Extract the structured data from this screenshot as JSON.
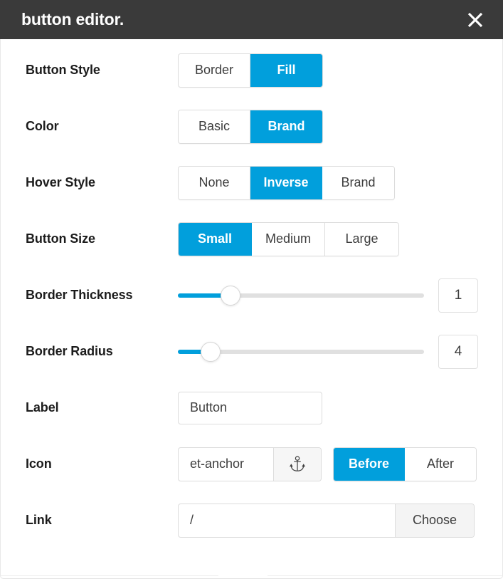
{
  "header": {
    "title": "button editor.",
    "close_label": "×"
  },
  "rows": {
    "button_style": {
      "label": "Button Style",
      "options": [
        "Border",
        "Fill"
      ],
      "selected": "Fill"
    },
    "color": {
      "label": "Color",
      "options": [
        "Basic",
        "Brand"
      ],
      "selected": "Brand"
    },
    "hover_style": {
      "label": "Hover Style",
      "options": [
        "None",
        "Inverse",
        "Brand"
      ],
      "selected": "Inverse"
    },
    "button_size": {
      "label": "Button Size",
      "options": [
        "Small",
        "Medium",
        "Large"
      ],
      "selected": "Small"
    },
    "border_thickness": {
      "label": "Border Thickness",
      "value": "1",
      "percent": 21
    },
    "border_radius": {
      "label": "Border Radius",
      "value": "4",
      "percent": 13
    },
    "label_field": {
      "label": "Label",
      "value": "Button",
      "placeholder": "Button"
    },
    "icon": {
      "label": "Icon",
      "value": "et-anchor",
      "placeholder": "et-anchor",
      "preview_icon": "anchor-icon",
      "position_options": [
        "Before",
        "After"
      ],
      "position_selected": "Before"
    },
    "link": {
      "label": "Link",
      "value": "/",
      "placeholder": "/",
      "choose_label": "Choose"
    }
  },
  "colors": {
    "accent": "#019fdc",
    "header_bg": "#3a3a3a",
    "text": "#1c1c1c",
    "border": "#dcdcdc"
  }
}
